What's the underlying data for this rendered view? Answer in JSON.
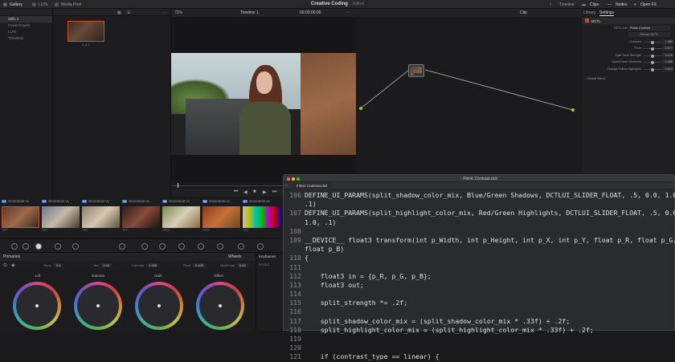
{
  "topbar": {
    "gallery": "Gallery",
    "luts": "LUTs",
    "media_pool": "Media Pool",
    "project": "Creative Coding",
    "status": "Edited",
    "timeline": "Timeline",
    "clips": "Clips",
    "nodes": "Nodes",
    "openfx": "Open FX"
  },
  "gallery": {
    "albums": [
      "Stills 1",
      "PowerGrades",
      "LUTs",
      "Timelines"
    ],
    "selected": 0,
    "still_label": "1.4.1"
  },
  "viewer": {
    "zoom": "73%",
    "timeline_name": "Timeline 1",
    "timecode": "00:00:00:00",
    "mode": "Clip"
  },
  "node_graph": {
    "node_label": "01"
  },
  "settings_panel": {
    "tab_library": "Library",
    "tab_settings": "Settings",
    "section": "DCTL",
    "dctl_list_label": "DCTL List",
    "dctl_list_value": "Filmic Contrast",
    "reload_label": "Reload DCTL",
    "params": [
      {
        "label": "Contrast",
        "value": "1.383"
      },
      {
        "label": "Pivot",
        "value": "0.477"
      },
      {
        "label": "Split Tone Strength",
        "value": "0.578"
      },
      {
        "label": "Cyan/Green Shadows",
        "value": "0.468"
      },
      {
        "label": "Orange/Yellow Highlights",
        "value": "0.523"
      }
    ],
    "global_blend": "Global Blend"
  },
  "clips": [
    {
      "num": "01",
      "tc": "00:00:00:00",
      "track": "V1",
      "label": "TIFF"
    },
    {
      "num": "02",
      "tc": "00:00:00:00",
      "track": "V1",
      "label": "TIFF"
    },
    {
      "num": "03",
      "tc": "00:00:00:00",
      "track": "V1",
      "label": "TIFF"
    },
    {
      "num": "04",
      "tc": "00:00:00:00",
      "track": "V1",
      "label": "TIFF"
    },
    {
      "num": "05",
      "tc": "00:00:00:00",
      "track": "V1",
      "label": "JPEG"
    },
    {
      "num": "06",
      "tc": "00:00:00:00",
      "track": "V1",
      "label": "JPEG"
    },
    {
      "num": "07",
      "tc": "00:00:00:00",
      "track": "V1",
      "label": "TIFF"
    }
  ],
  "primaries": {
    "title": "Primaries",
    "wheels_mode": "Wheels",
    "keyframes": "Keyframes",
    "keyframes_tc": "01:00:0",
    "params": [
      {
        "label": "Temp",
        "value": "0.0"
      },
      {
        "label": "Tint",
        "value": "0.00"
      },
      {
        "label": "Contrast",
        "value": "1.000"
      },
      {
        "label": "Pivot",
        "value": "0.435"
      },
      {
        "label": "Mid/Detail",
        "value": "0.00"
      }
    ],
    "wheels": [
      "Lift",
      "Gamma",
      "Gain",
      "Offset"
    ]
  },
  "editor": {
    "filename": "Filmic Contrast.dctl",
    "tab": "Filmic Contrast.dctl",
    "lines": [
      {
        "n": "106",
        "t": "DEFINE_UI_PARAMS(split_shadow_color_mix, Blue/Green Shadows, DCTLUI_SLIDER_FLOAT, .5, 0.0, 1.0,"
      },
      {
        "n": "",
        "t": ".1)"
      },
      {
        "n": "107",
        "t": "DEFINE_UI_PARAMS(split_highlight_color_mix, Red/Green Highlights, DCTLUI_SLIDER_FLOAT, .5, 0.0,"
      },
      {
        "n": "",
        "t": "1.0, .1)"
      },
      {
        "n": "108",
        "t": ""
      },
      {
        "n": "109",
        "t": "__DEVICE__ float3 transform(int p_Width, int p_Height, int p_X, int p_Y, float p_R, float p_G,"
      },
      {
        "n": "",
        "t": "float p_B)"
      },
      {
        "n": "110",
        "t": "{"
      },
      {
        "n": "111",
        "t": ""
      },
      {
        "n": "112",
        "t": "    float3 in = {p_R, p_G, p_B};"
      },
      {
        "n": "113",
        "t": "    float3 out;"
      },
      {
        "n": "114",
        "t": ""
      },
      {
        "n": "115",
        "t": "    split_strength *= .2f;"
      },
      {
        "n": "116",
        "t": ""
      },
      {
        "n": "117",
        "t": "    split_shadow_color_mix = (split_shadow_color_mix * .33f) + .2f;"
      },
      {
        "n": "118",
        "t": "    split_highlight_color_mix = (split_highlight_color_mix * .33f) + .2f;"
      },
      {
        "n": "119",
        "t": ""
      },
      {
        "n": "120",
        "t": ""
      },
      {
        "n": "121",
        "t": "    if (contrast_type == linear) {"
      }
    ]
  }
}
